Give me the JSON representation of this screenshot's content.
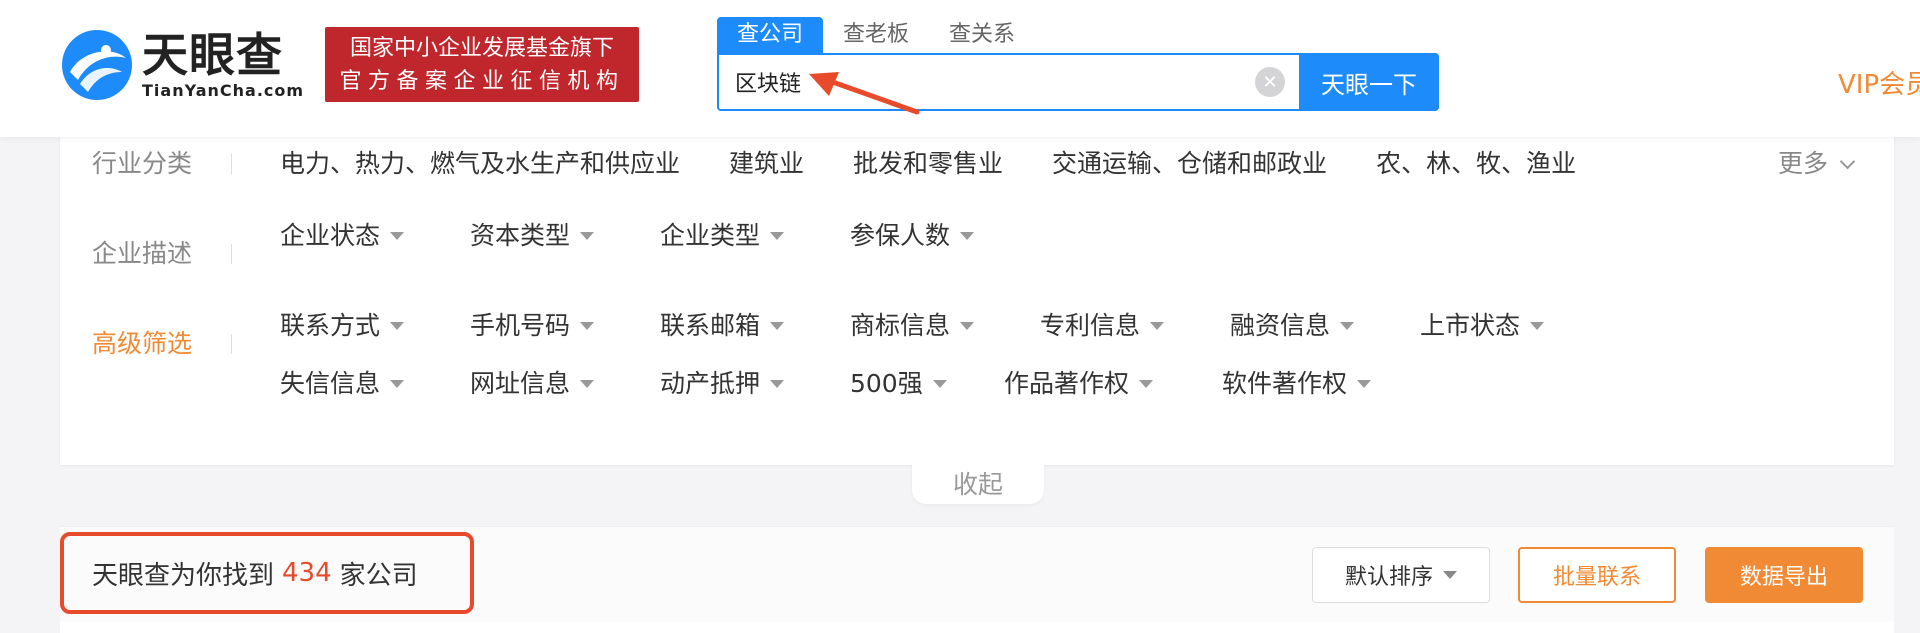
{
  "brand": {
    "name_cn": "天眼查",
    "name_en": "TianYanCha.com",
    "slogan_line1": "国家中小企业发展基金旗下",
    "slogan_line2": "官方备案企业征信机构",
    "logo_color": "#1d8bfa"
  },
  "search": {
    "tabs": [
      {
        "label": "查公司",
        "active": true
      },
      {
        "label": "查老板",
        "active": false
      },
      {
        "label": "查关系",
        "active": false
      }
    ],
    "value": "区块链",
    "button_label": "天眼一下"
  },
  "header": {
    "vip_label": "VIP会员"
  },
  "filters": {
    "industry": {
      "label": "行业分类",
      "items": [
        "电力、热力、燃气及水生产和供应业",
        "建筑业",
        "批发和零售业",
        "交通运输、仓储和邮政业",
        "农、林、牧、渔业"
      ],
      "more_label": "更多"
    },
    "description": {
      "label": "企业描述",
      "items": [
        "企业状态",
        "资本类型",
        "企业类型",
        "参保人数"
      ]
    },
    "advanced": {
      "label": "高级筛选",
      "row1": [
        "联系方式",
        "手机号码",
        "联系邮箱",
        "商标信息",
        "专利信息",
        "融资信息",
        "上市状态"
      ],
      "row2": [
        "失信信息",
        "网址信息",
        "动产抵押",
        "500强",
        "作品著作权",
        "软件著作权"
      ]
    },
    "collapse_label": "收起"
  },
  "results": {
    "prefix": "天眼查为你找到",
    "count": "434",
    "suffix": "家公司",
    "sort_label": "默认排序",
    "batch_contact_label": "批量联系",
    "export_label": "数据导出"
  },
  "colors": {
    "primary": "#1d8bfa",
    "accent_orange": "#f08a35",
    "highlight_red": "#e84a2c",
    "slogan_red": "#c0272d"
  }
}
